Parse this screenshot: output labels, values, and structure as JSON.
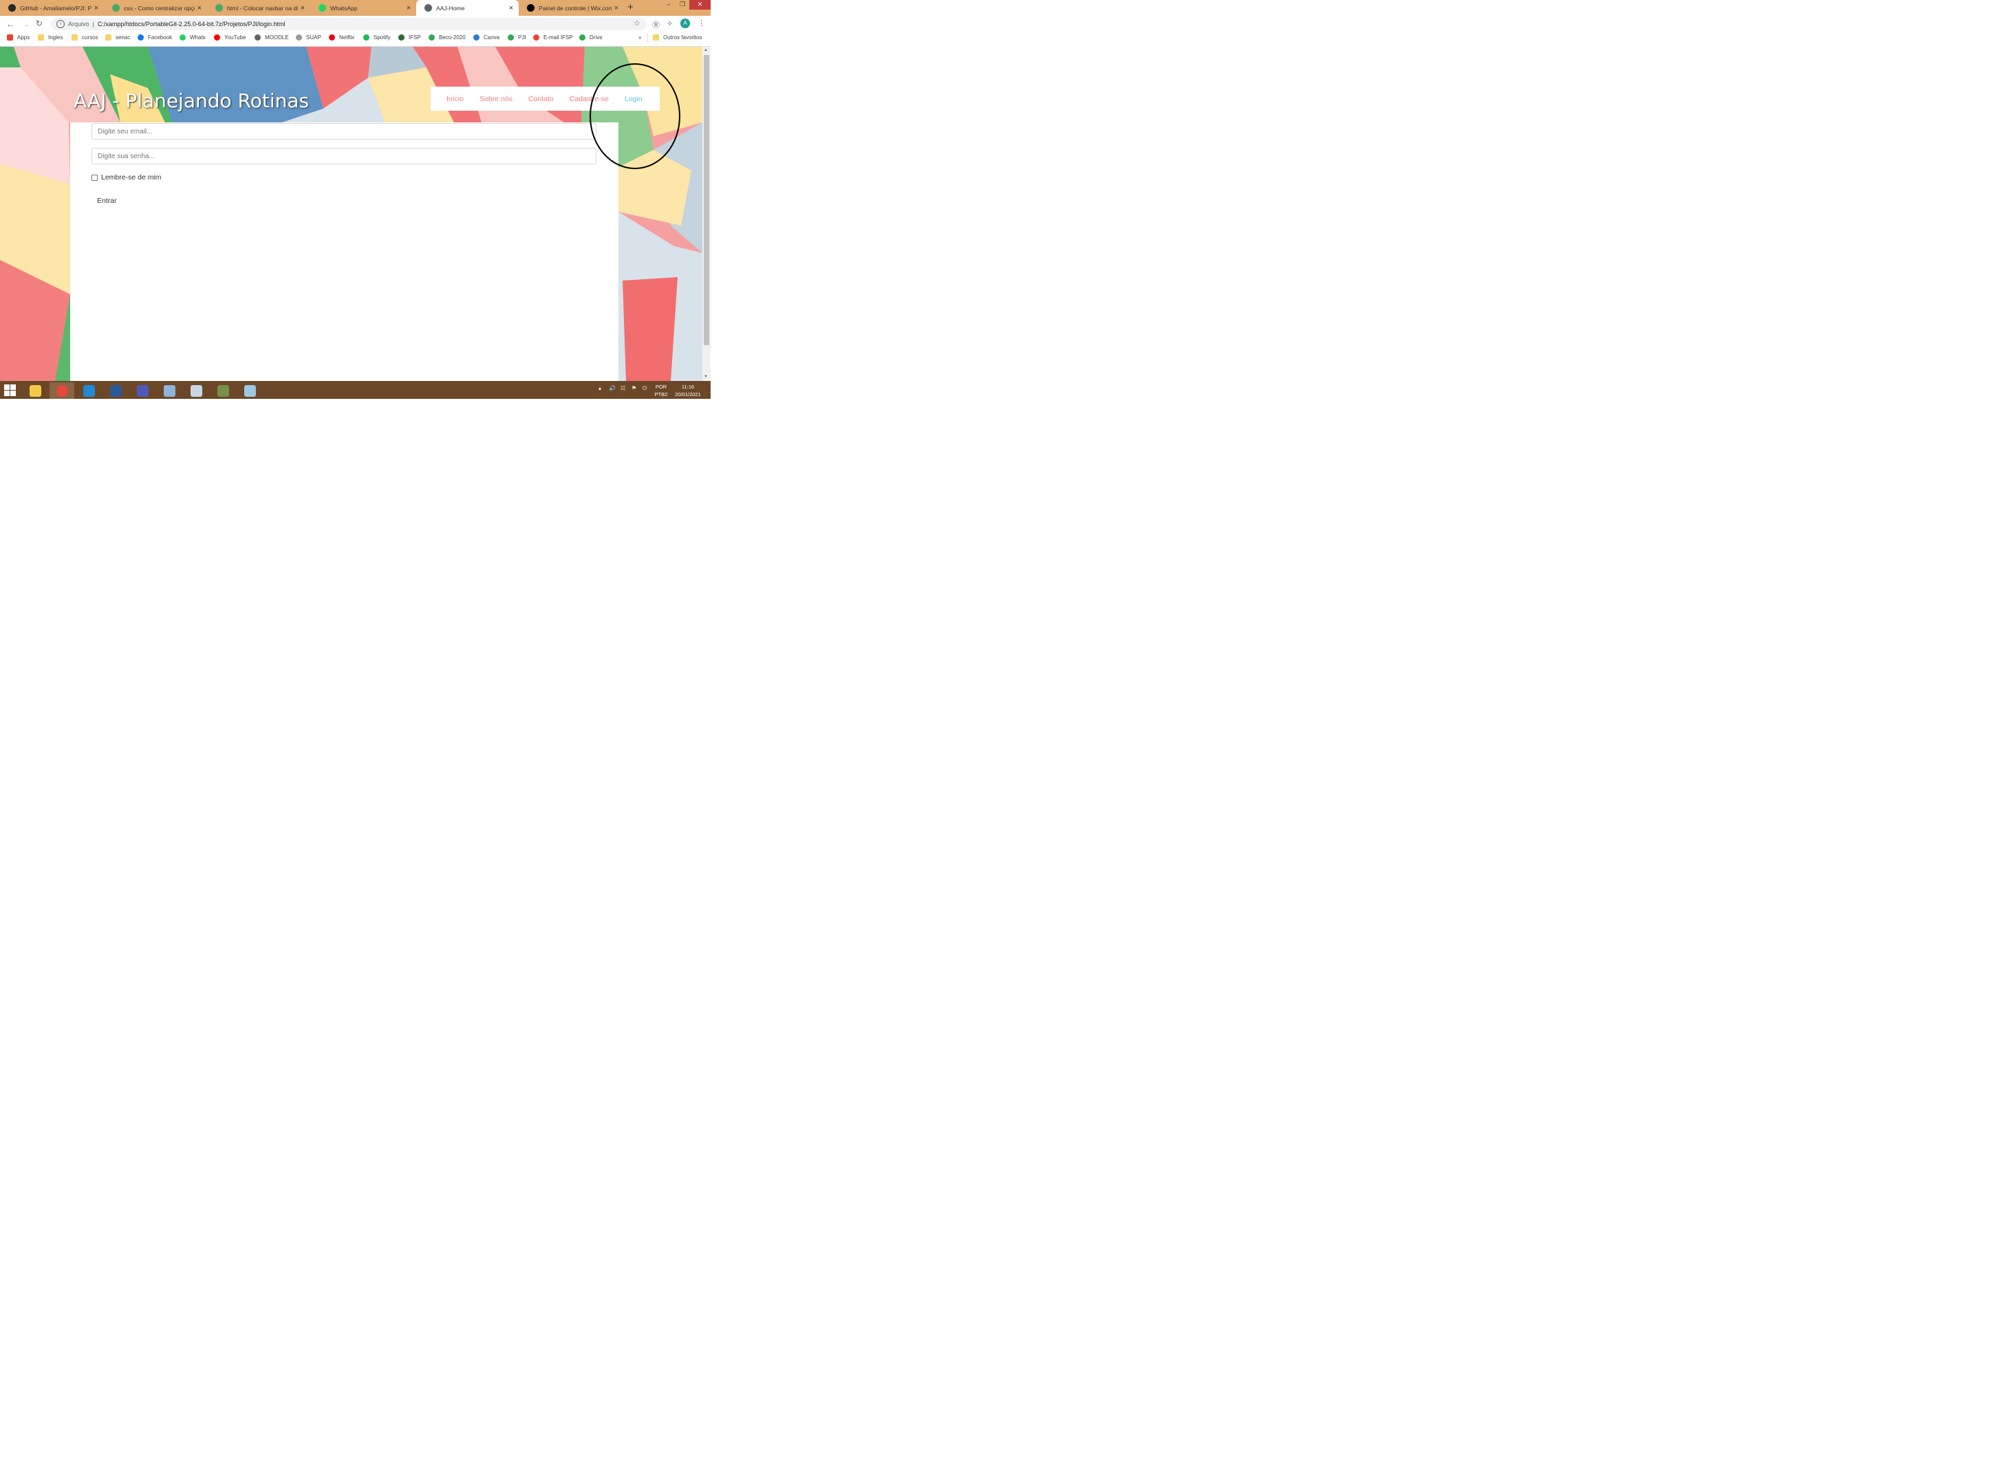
{
  "browser": {
    "tabs": [
      {
        "title": "GitHub - Amaliamelo/PJI: Proj",
        "favicon_color": "#24292e",
        "favicon": "github-icon"
      },
      {
        "title": "css - Como centralizar opções",
        "favicon_color": "#48a868",
        "favicon": "stackoverflow-icon"
      },
      {
        "title": "html - Colocar navbar na direi",
        "favicon_color": "#48a868",
        "favicon": "stackoverflow-icon"
      },
      {
        "title": "WhatsApp",
        "favicon_color": "#25d366",
        "favicon": "whatsapp-icon"
      },
      {
        "title": "AAJ-Home",
        "favicon_color": "#5f6368",
        "favicon": "globe-icon",
        "active": true
      },
      {
        "title": "Painel de controle | Wix.com",
        "favicon_color": "#000000",
        "favicon": "wix-icon"
      }
    ],
    "close_glyph": "×",
    "new_tab_glyph": "+",
    "window_controls": {
      "minimize": "–",
      "restore": "❐",
      "close": "✕"
    },
    "address": {
      "scheme_label": "Arquivo",
      "url": "C:/xampp/htdocs/PortableGit-2.25.0-64-bit.7z/Projetos/PJI/login.html"
    },
    "profile_initial": "A",
    "bookmarks": [
      {
        "label": "Apps",
        "icon": "apps-grid-icon",
        "color": "#ea4335"
      },
      {
        "label": "Ingles",
        "icon": "folder-icon",
        "color": "#f6d36b"
      },
      {
        "label": "cursos",
        "icon": "folder-icon",
        "color": "#f6d36b"
      },
      {
        "label": "senac",
        "icon": "folder-icon",
        "color": "#f6d36b"
      },
      {
        "label": "Facebook",
        "icon": "facebook-icon",
        "color": "#1877f2"
      },
      {
        "label": "Whats",
        "icon": "whatsapp-icon",
        "color": "#25d366"
      },
      {
        "label": "YouTube",
        "icon": "youtube-icon",
        "color": "#ff0000"
      },
      {
        "label": "MOODLE",
        "icon": "globe-icon",
        "color": "#5f6368"
      },
      {
        "label": "SUAP",
        "icon": "suap-icon",
        "color": "#999999"
      },
      {
        "label": "Netflix",
        "icon": "netflix-icon",
        "color": "#e50914"
      },
      {
        "label": "Spotify",
        "icon": "spotify-icon",
        "color": "#1db954"
      },
      {
        "label": "IFSP",
        "icon": "ifsp-icon",
        "color": "#2b6b3a"
      },
      {
        "label": "Beco-2020",
        "icon": "drive-icon",
        "color": "#34a853"
      },
      {
        "label": "Canva",
        "icon": "canva-icon",
        "color": "#2a7bd3"
      },
      {
        "label": "PJI",
        "icon": "drive-icon",
        "color": "#34a853"
      },
      {
        "label": "E-mail IFSP",
        "icon": "gmail-icon",
        "color": "#ea4335"
      },
      {
        "label": "Drive",
        "icon": "drive-icon",
        "color": "#34a853"
      }
    ],
    "bookmarks_overflow": "»",
    "other_bookmarks": "Outros favoritos"
  },
  "site": {
    "title": "AAJ - Planejando Rotinas",
    "nav": [
      {
        "label": "Início",
        "active": false
      },
      {
        "label": "Sobre nós",
        "active": false
      },
      {
        "label": "Contato",
        "active": false
      },
      {
        "label": "Cadastre-se",
        "active": false
      },
      {
        "label": "Login",
        "active": true
      }
    ],
    "nav_color": "#f27a7d",
    "nav_active_color": "#5bc0de"
  },
  "login_form": {
    "email_placeholder": "Digite seu email...",
    "password_placeholder": "Digite sua senha...",
    "remember_label": "Lembre-se de mim",
    "remember_checked": false,
    "submit_label": "Entrar"
  },
  "taskbar": {
    "apps": [
      "file-explorer-icon",
      "chrome-icon",
      "vscode-icon",
      "word-icon",
      "teams-icon",
      "paint-icon",
      "calculator-icon",
      "git-icon",
      "notepad-icon"
    ],
    "active_app": "chrome-icon",
    "tray_language": "POR",
    "tray_layout": "PTB2",
    "time": "11:16",
    "date": "20/01/2021"
  }
}
